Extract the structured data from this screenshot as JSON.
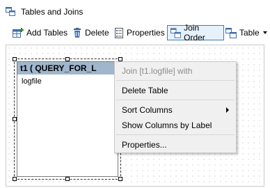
{
  "window": {
    "title": "Tables and Joins"
  },
  "toolbar": {
    "add_tables": "Add Tables",
    "delete": "Delete",
    "properties": "Properties",
    "join_order": "Join Order",
    "table": "Table"
  },
  "table_box": {
    "header": "t1 ( QUERY_FOR_L",
    "columns": [
      "logfile"
    ]
  },
  "context_menu": {
    "join": "Join [t1.logfile] with",
    "delete_table": "Delete Table",
    "sort_columns": "Sort Columns",
    "show_columns": "Show Columns by Label",
    "properties": "Properties..."
  },
  "colors": {
    "accent": "#3c7fb1",
    "table_header": "#9fb6cd",
    "menu_bg": "#f0f0f0"
  }
}
